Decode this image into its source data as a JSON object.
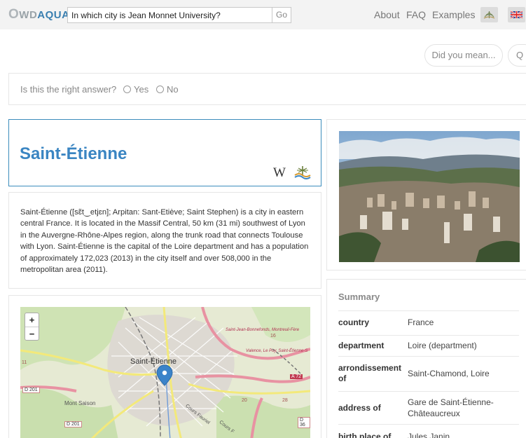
{
  "header": {
    "logo_o": "O",
    "logo_wd": "WD",
    "logo_aqua": "AQUA",
    "search_value": "In which city is Jean Monnet University?",
    "go_label": "Go",
    "nav": [
      "About",
      "FAQ",
      "Examples"
    ],
    "flags": [
      "language-icon",
      "uk-flag-icon"
    ]
  },
  "suggestions": {
    "did_you_mean": "Did you mean...",
    "q": "Q"
  },
  "feedback": {
    "question": "Is this the right answer?",
    "yes": "Yes",
    "no": "No"
  },
  "result": {
    "title": "Saint-Étienne",
    "wiki_label": "W",
    "description": "Saint-Étienne ([sɛ̃t‿etjɛn]; Arpitan: Sant-Etiève; Saint Stephen) is a city in eastern central France. It is located in the Massif Central, 50 km (31 mi) southwest of Lyon in the Auvergne-Rhône-Alpes region, along the trunk road that connects Toulouse with Lyon. Saint-Étienne is the capital of the Loire department and has a population of approximately 172,023 (2013) in the city itself and over 508,000 in the metropolitan area (2011)."
  },
  "map": {
    "zoom_in": "+",
    "zoom_out": "−",
    "labels": {
      "city": "Saint-Étienne",
      "mont_saison": "Mont Saison",
      "d201_a": "D 201",
      "d201_b": "D 201",
      "a72": "A 72",
      "d36": "D 36",
      "n28": "28",
      "n20": "20",
      "n16": "16",
      "n11": "11",
      "road_a": "Saint-Jean-Bonnefonds, Montreuil-Fère",
      "road_b": "Valence, Le Puy, Saint-Étienne-S",
      "cours_fauriel": "Cours Fauriel",
      "cours_b": "Cours F"
    }
  },
  "summary": {
    "title": "Summary",
    "rows": [
      {
        "key": "country",
        "value": "France"
      },
      {
        "key": "department",
        "value": "Loire (department)"
      },
      {
        "key": "arrondissement of",
        "value": "Saint-Chamond, Loire"
      },
      {
        "key": "address of",
        "value": "Gare de Saint-Étienne-Châteaucreux"
      },
      {
        "key": "birth place of",
        "value": "Jules Janin"
      }
    ]
  },
  "colors": {
    "accent": "#3a85c2",
    "card_border_active": "#3c8dbc",
    "topbar": "#f3f3f3",
    "map_road_major": "#e892a2",
    "map_road_minor": "#f7fabf"
  }
}
